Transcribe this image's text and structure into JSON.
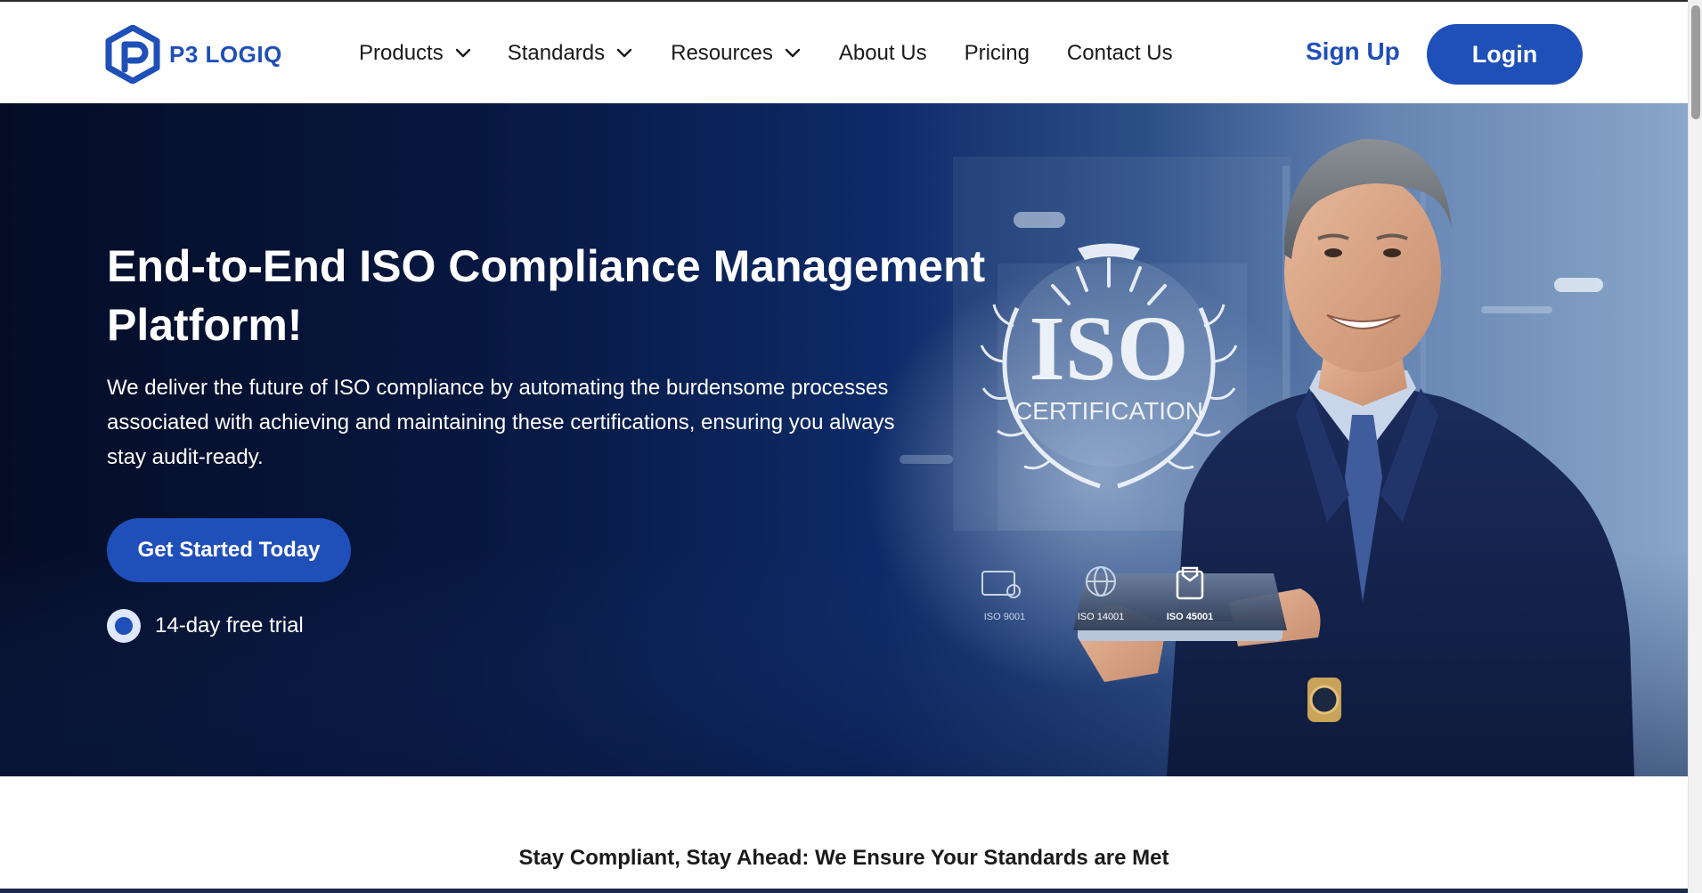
{
  "brand": {
    "name": "P3 LOGIQ",
    "color": "#1f4fb8",
    "logo_icon": "p3-hexagon-logo-icon"
  },
  "nav": {
    "items": [
      {
        "label": "Products",
        "has_dropdown": true
      },
      {
        "label": "Standards",
        "has_dropdown": true
      },
      {
        "label": "Resources",
        "has_dropdown": true
      },
      {
        "label": "About Us",
        "has_dropdown": false
      },
      {
        "label": "Pricing",
        "has_dropdown": false
      },
      {
        "label": "Contact Us",
        "has_dropdown": false
      }
    ],
    "signup_label": "Sign Up",
    "login_label": "Login"
  },
  "hero": {
    "title": "End-to-End ISO Compliance Management Platform!",
    "description": "We deliver the future of ISO compliance by automating the burdensome processes associated with achieving and maintaining these certifications, ensuring you always stay audit-ready.",
    "cta_label": "Get Started Today",
    "trial_label": "14-day free trial",
    "badge": {
      "title": "ISO",
      "subtitle": "CERTIFICATION",
      "standards": [
        "ISO 9001",
        "ISO 14001",
        "ISO 45001"
      ]
    }
  },
  "section": {
    "tagline": "Stay Compliant, Stay Ahead: We Ensure Your Standards are Met"
  },
  "colors": {
    "accent": "#1f4fb8",
    "hero_dark": "#07173f",
    "text": "#1a1a1a"
  }
}
